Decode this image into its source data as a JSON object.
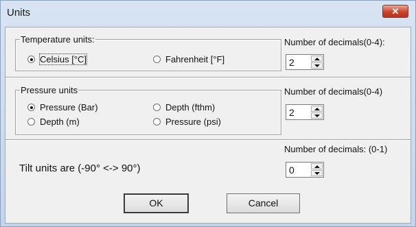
{
  "window": {
    "title": "Units",
    "close_label": "✕"
  },
  "temperature": {
    "legend": "Temperature units:",
    "options": [
      {
        "label": "Celsius [°C]",
        "selected": true
      },
      {
        "label": "Fahrenheit [°F]",
        "selected": false
      }
    ],
    "decimals_label": "Number of decimals(0-4):",
    "decimals_value": "2"
  },
  "pressure": {
    "legend": "Pressure units",
    "options": [
      {
        "label": "Pressure (Bar)",
        "selected": true
      },
      {
        "label": "Depth (fthm)",
        "selected": false
      },
      {
        "label": "Depth (m)",
        "selected": false
      },
      {
        "label": "Pressure (psi)",
        "selected": false
      }
    ],
    "decimals_label": "Number of decimals(0-4)",
    "decimals_value": "2"
  },
  "tilt": {
    "text": "Tilt units are (-90° <-> 90°)",
    "decimals_label": "Number of decimals:  (0-1)",
    "decimals_value": "0"
  },
  "buttons": {
    "ok": "OK",
    "cancel": "Cancel"
  },
  "colors": {
    "titlebar": "#c4d5ea",
    "close": "#c8442a",
    "dialog_bg": "#f0f0f0"
  }
}
